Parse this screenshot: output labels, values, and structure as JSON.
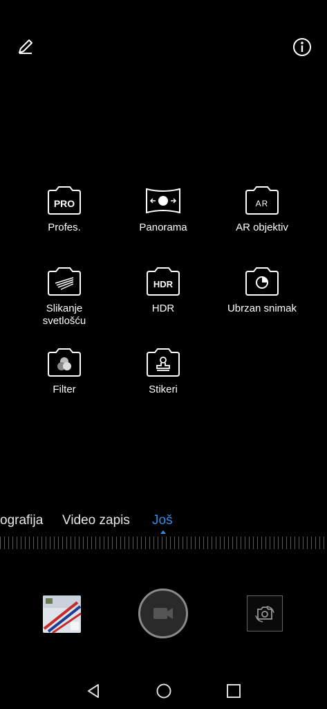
{
  "top_bar": {
    "edit_icon": "pencil-icon",
    "info_icon": "info-icon"
  },
  "modes": [
    {
      "label": "Profes.",
      "icon": "pro-icon",
      "badge": "PRO"
    },
    {
      "label": "Panorama",
      "icon": "panorama-icon"
    },
    {
      "label": "AR objektiv",
      "icon": "ar-lens-icon",
      "badge": "AR"
    },
    {
      "label": "Slikanje\nsvetlošću",
      "icon": "light-painting-icon"
    },
    {
      "label": "HDR",
      "icon": "hdr-icon",
      "badge": "HDR"
    },
    {
      "label": "Ubrzan snimak",
      "icon": "time-lapse-icon"
    },
    {
      "label": "Filter",
      "icon": "filter-icon"
    },
    {
      "label": "Stikeri",
      "icon": "stickers-icon"
    }
  ],
  "mode_tabs": [
    {
      "label": "ografija"
    },
    {
      "label": "Video zapis"
    },
    {
      "label": "Još",
      "active": true
    }
  ],
  "bottom_controls": {
    "gallery": "gallery-thumbnail",
    "shutter": "video-record-button",
    "switch": "switch-camera-icon"
  },
  "nav_bar": [
    "back-icon",
    "home-icon",
    "recents-icon"
  ],
  "colors": {
    "accent": "#2f8fe8",
    "background": "#000000"
  }
}
